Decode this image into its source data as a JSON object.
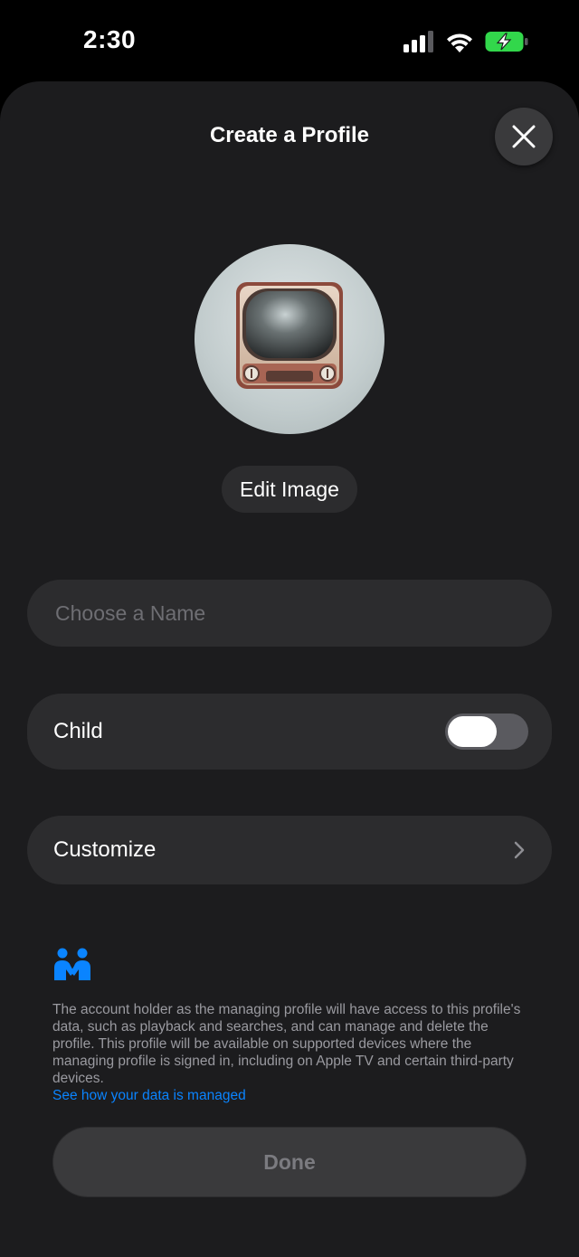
{
  "status_bar": {
    "time": "2:30",
    "icons": [
      "cellular-signal-icon",
      "wifi-icon",
      "battery-charging-icon"
    ],
    "battery_color": "#32d74b"
  },
  "sheet": {
    "title": "Create a Profile",
    "close_icon": "close-icon"
  },
  "avatar": {
    "icon": "television-icon",
    "edit_label": "Edit Image"
  },
  "form": {
    "name_placeholder": "Choose a Name",
    "name_value": "",
    "child_label": "Child",
    "child_toggle_on": false,
    "customize_label": "Customize",
    "customize_icon": "chevron-right-icon"
  },
  "info": {
    "icon": "family-sharing-icon",
    "text": "The account holder as the managing profile will have access to this profile's data, such as playback and searches, and can manage and delete the profile. This profile will be available on supported devices where the managing profile is signed in, including on Apple TV and certain third-party devices.",
    "link": "See how your data is managed"
  },
  "actions": {
    "done_label": "Done",
    "done_enabled": false
  },
  "colors": {
    "sheet_background": "#1c1c1e",
    "field_background": "#2c2c2e",
    "accent_link": "#0a84ff"
  }
}
